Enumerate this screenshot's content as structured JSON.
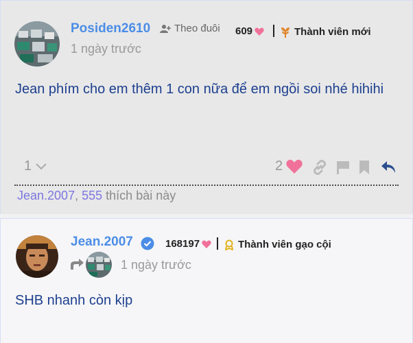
{
  "post1": {
    "username": "Posiden2610",
    "follow_label": "Theo đuôi",
    "likes_count": "609",
    "rank": "Thành viên mới",
    "time": "1 ngày trước",
    "body": "Jean phím cho em thêm 1 con nữa để em ngồi soi nhé hihihi",
    "reply_count": "1",
    "like_count": "2",
    "liked_by": {
      "user1": "Jean.2007",
      "sep": ",",
      "user2": "555",
      "suffix": "thích bài này"
    }
  },
  "post2": {
    "username": "Jean.2007",
    "likes_count": "168197",
    "rank": "Thành viên gạo cội",
    "time": "1 ngày trước",
    "body": "SHB nhanh còn kịp"
  },
  "colors": {
    "username": "#4b8de6",
    "body_text": "#1c3f8f",
    "heart": "#f0729a",
    "reply_arrow": "#2d4f8f",
    "rank_icon_new": "#e0862c",
    "rank_icon_veteran": "#e2b21e"
  },
  "icons": [
    "user-plus-icon",
    "heart-icon",
    "sprout-icon",
    "verified-check-icon",
    "medal-icon",
    "chevron-down-icon",
    "link-icon",
    "flag-icon",
    "bookmark-icon",
    "reply-icon",
    "reply-to-icon"
  ]
}
